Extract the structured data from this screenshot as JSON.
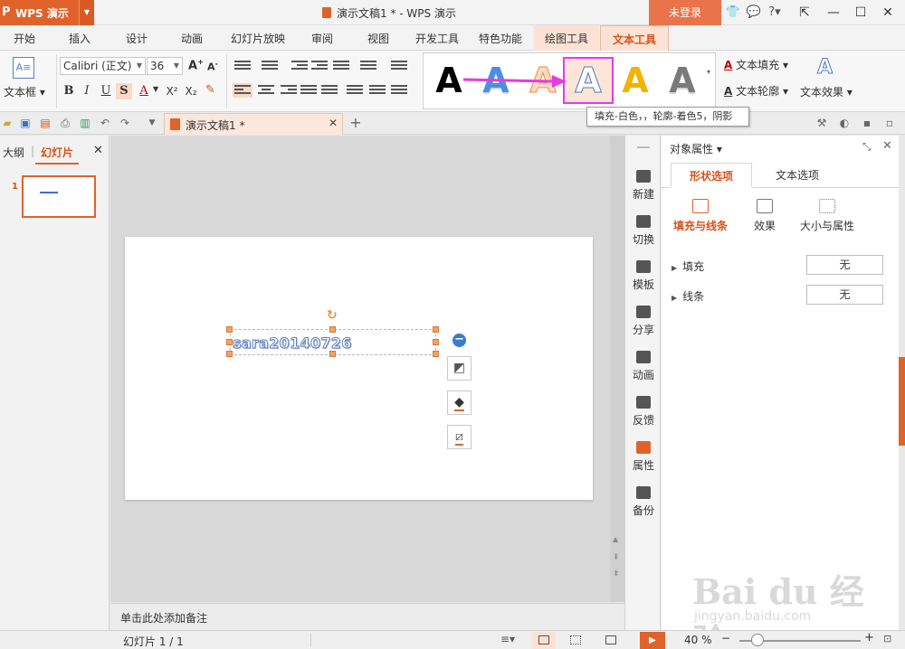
{
  "titlebar": {
    "app_logo": "P",
    "app_name": "WPS 演示",
    "doc_title": "演示文稿1 * - WPS 演示",
    "login_label": "未登录"
  },
  "menu": {
    "tabs": [
      "开始",
      "插入",
      "设计",
      "动画",
      "幻灯片放映",
      "审阅",
      "视图",
      "开发工具",
      "特色功能",
      "绘图工具",
      "文本工具"
    ],
    "active_tab": "文本工具"
  },
  "ribbon": {
    "textbox_label": "文本框",
    "font_name": "Calibri (正文)",
    "font_size": "36",
    "bold": "B",
    "italic": "I",
    "underline": "U",
    "strike": "S",
    "font_color": "A",
    "superscript": "X²",
    "subscript": "X₂",
    "text_fill_label": "文本填充",
    "text_outline_label": "文本轮廓",
    "text_effect_label": "文本效果",
    "style_gallery": [
      {
        "glyph": "A",
        "name": "black",
        "color": "#000000"
      },
      {
        "glyph": "A",
        "name": "blue-gradient",
        "color": "#4a90e2"
      },
      {
        "glyph": "A",
        "name": "orange-outline",
        "color": "#f28c38"
      },
      {
        "glyph": "A",
        "name": "white-fill-outline",
        "color": "#4a78c8"
      },
      {
        "glyph": "A",
        "name": "gold",
        "color": "#f0b400"
      },
      {
        "glyph": "A",
        "name": "gray-gradient",
        "color": "#7a7a7a"
      }
    ],
    "accent_color": "#e0622b",
    "highlight_color": "#e63ae6"
  },
  "tooltip": "填充-白色，，轮廓-着色5，阴影",
  "quickbar": {
    "doc_tab_label": "演示文稿1 *"
  },
  "leftpane": {
    "outline_tab": "大纲",
    "slides_tab": "幻灯片",
    "slide_number": "1"
  },
  "slide": {
    "textbox_text": "sara20140726"
  },
  "notes_placeholder": "单击此处添加备注",
  "sidebar": {
    "items": [
      "新建",
      "切换",
      "模板",
      "分享",
      "动画",
      "反馈",
      "属性",
      "备份"
    ]
  },
  "props": {
    "title": "对象属性",
    "tabs": [
      "形状选项",
      "文本选项"
    ],
    "subtabs": [
      "填充与线条",
      "效果",
      "大小与属性"
    ],
    "fill_label": "填充",
    "fill_value": "无",
    "line_label": "线条",
    "line_value": "无"
  },
  "statusbar": {
    "slide_info": "幻灯片 1 / 1",
    "zoom": "40 %"
  },
  "watermark": {
    "big": "Bai du 经验",
    "small": "jingyan.baidu.com"
  }
}
